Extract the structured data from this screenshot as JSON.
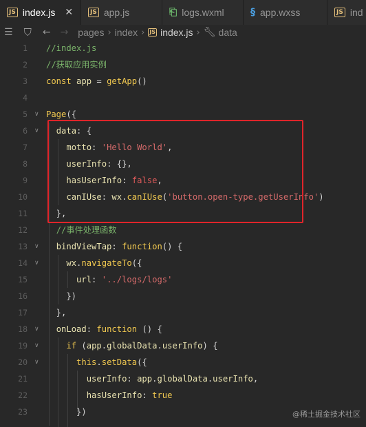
{
  "tabs": [
    {
      "label": "index.js",
      "type": "js",
      "active": true,
      "close": "✕"
    },
    {
      "label": "app.js",
      "type": "js",
      "active": false
    },
    {
      "label": "logs.wxml",
      "type": "wxml",
      "active": false
    },
    {
      "label": "app.wxss",
      "type": "wxss",
      "active": false
    },
    {
      "label": "ind",
      "type": "js",
      "active": false
    }
  ],
  "breadcrumb": {
    "items": [
      "pages",
      "index",
      "index.js",
      "data"
    ]
  },
  "code_lines": [
    {
      "n": "1",
      "tokens": [
        [
          "c-com",
          "//index.js"
        ]
      ]
    },
    {
      "n": "2",
      "tokens": [
        [
          "c-com",
          "//获取应用实例"
        ]
      ]
    },
    {
      "n": "3",
      "tokens": [
        [
          "c-kw",
          "const "
        ],
        [
          "c-var",
          "app"
        ],
        [
          "c-pun",
          " = "
        ],
        [
          "c-fn",
          "getApp"
        ],
        [
          "c-pun",
          "()"
        ]
      ]
    },
    {
      "n": "4",
      "tokens": []
    },
    {
      "n": "5",
      "fold": true,
      "tokens": [
        [
          "c-fn",
          "Page"
        ],
        [
          "c-pun",
          "({"
        ]
      ]
    },
    {
      "n": "6",
      "fold": true,
      "tokens": [
        [
          "c-pun",
          "  "
        ],
        [
          "c-prop",
          "data"
        ],
        [
          "c-pun",
          ": {"
        ]
      ]
    },
    {
      "n": "7",
      "tokens": [
        [
          "c-pun",
          "    "
        ],
        [
          "c-prop",
          "motto"
        ],
        [
          "c-pun",
          ": "
        ],
        [
          "c-str",
          "'Hello World'"
        ],
        [
          "c-pun",
          ","
        ]
      ]
    },
    {
      "n": "8",
      "tokens": [
        [
          "c-pun",
          "    "
        ],
        [
          "c-prop",
          "userInfo"
        ],
        [
          "c-pun",
          ": {},"
        ]
      ]
    },
    {
      "n": "9",
      "tokens": [
        [
          "c-pun",
          "    "
        ],
        [
          "c-prop",
          "hasUserInfo"
        ],
        [
          "c-pun",
          ": "
        ],
        [
          "c-bool",
          "false"
        ],
        [
          "c-pun",
          ","
        ]
      ]
    },
    {
      "n": "10",
      "tokens": [
        [
          "c-pun",
          "    "
        ],
        [
          "c-prop",
          "canIUse"
        ],
        [
          "c-pun",
          ": "
        ],
        [
          "c-var",
          "wx"
        ],
        [
          "c-pun",
          "."
        ],
        [
          "c-fn",
          "canIUse"
        ],
        [
          "c-pun",
          "("
        ],
        [
          "c-str",
          "'button.open-type.getUserInfo'"
        ],
        [
          "c-pun",
          ")"
        ]
      ]
    },
    {
      "n": "11",
      "tokens": [
        [
          "c-pun",
          "  },"
        ]
      ]
    },
    {
      "n": "12",
      "tokens": [
        [
          "c-pun",
          "  "
        ],
        [
          "c-com",
          "//事件处理函数"
        ]
      ]
    },
    {
      "n": "13",
      "fold": true,
      "tokens": [
        [
          "c-pun",
          "  "
        ],
        [
          "c-prop",
          "bindViewTap"
        ],
        [
          "c-pun",
          ": "
        ],
        [
          "c-kw",
          "function"
        ],
        [
          "c-pun",
          "() {"
        ]
      ]
    },
    {
      "n": "14",
      "fold": true,
      "tokens": [
        [
          "c-pun",
          "    "
        ],
        [
          "c-var",
          "wx"
        ],
        [
          "c-pun",
          "."
        ],
        [
          "c-fn",
          "navigateTo"
        ],
        [
          "c-pun",
          "({"
        ]
      ]
    },
    {
      "n": "15",
      "tokens": [
        [
          "c-pun",
          "      "
        ],
        [
          "c-prop",
          "url"
        ],
        [
          "c-pun",
          ": "
        ],
        [
          "c-str",
          "'../logs/logs'"
        ]
      ]
    },
    {
      "n": "16",
      "tokens": [
        [
          "c-pun",
          "    })"
        ]
      ]
    },
    {
      "n": "17",
      "tokens": [
        [
          "c-pun",
          "  },"
        ]
      ]
    },
    {
      "n": "18",
      "fold": true,
      "tokens": [
        [
          "c-pun",
          "  "
        ],
        [
          "c-prop",
          "onLoad"
        ],
        [
          "c-pun",
          ": "
        ],
        [
          "c-kw",
          "function"
        ],
        [
          "c-pun",
          " () {"
        ]
      ]
    },
    {
      "n": "19",
      "fold": true,
      "tokens": [
        [
          "c-pun",
          "    "
        ],
        [
          "c-kw",
          "if"
        ],
        [
          "c-pun",
          " ("
        ],
        [
          "c-var",
          "app"
        ],
        [
          "c-pun",
          "."
        ],
        [
          "c-prop",
          "globalData"
        ],
        [
          "c-pun",
          "."
        ],
        [
          "c-prop",
          "userInfo"
        ],
        [
          "c-pun",
          ") {"
        ]
      ]
    },
    {
      "n": "20",
      "fold": true,
      "tokens": [
        [
          "c-pun",
          "      "
        ],
        [
          "c-kw",
          "this"
        ],
        [
          "c-pun",
          "."
        ],
        [
          "c-fn",
          "setData"
        ],
        [
          "c-pun",
          "({"
        ]
      ]
    },
    {
      "n": "21",
      "tokens": [
        [
          "c-pun",
          "        "
        ],
        [
          "c-prop",
          "userInfo"
        ],
        [
          "c-pun",
          ": "
        ],
        [
          "c-var",
          "app"
        ],
        [
          "c-pun",
          "."
        ],
        [
          "c-prop",
          "globalData"
        ],
        [
          "c-pun",
          "."
        ],
        [
          "c-prop",
          "userInfo"
        ],
        [
          "c-pun",
          ","
        ]
      ]
    },
    {
      "n": "22",
      "tokens": [
        [
          "c-pun",
          "        "
        ],
        [
          "c-prop",
          "hasUserInfo"
        ],
        [
          "c-pun",
          ": "
        ],
        [
          "c-bool2",
          "true"
        ]
      ]
    },
    {
      "n": "23",
      "tokens": [
        [
          "c-pun",
          "      })"
        ]
      ]
    }
  ],
  "watermark": "@稀土掘金技术社区",
  "colors": {
    "background": "#282828",
    "highlight_box": "#e0242a",
    "comment": "#7ab36a",
    "keyword": "#f0c850",
    "string": "#d46a6a"
  },
  "icons": {
    "menu": "list-icon",
    "bookmark": "bookmark-icon",
    "back": "arrow-left-icon",
    "forward": "arrow-right-icon",
    "property": "wrench-icon"
  }
}
